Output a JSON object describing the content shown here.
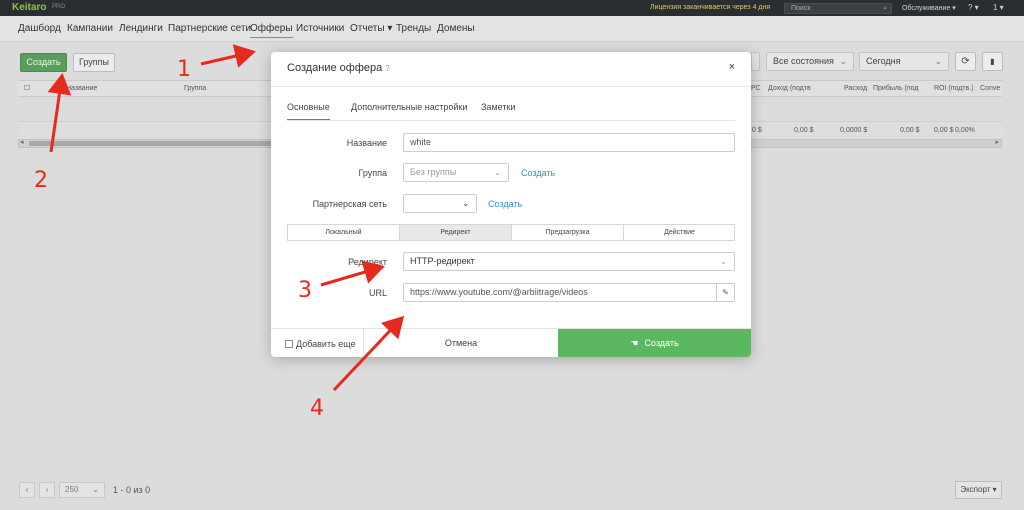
{
  "topbar": {
    "logo": "Keitaro",
    "logo_sub": "PRO",
    "license": "Лицензия заканчивается через 4 дня",
    "search_placeholder": "Поиск",
    "service": "Обслуживание ▾",
    "help": "? ▾",
    "user": "1 ▾"
  },
  "nav": {
    "items": [
      "Дашборд",
      "Кампании",
      "Лендинги",
      "Партнерские сети",
      "Офферы",
      "Источники",
      "Отчеты ▾",
      "Тренды",
      "Домены"
    ],
    "active": "Офферы"
  },
  "toolbar": {
    "create": "Создать",
    "groups": "Группы",
    "states": "Все состояния",
    "period": "Сегодня"
  },
  "table": {
    "headers_left": [
      "Название",
      "Группа"
    ],
    "headers_right": [
      "PC",
      "Доход (подтв",
      "Расход",
      "Прибыль (под",
      "ROI (подтв.)",
      "Conve"
    ],
    "row_values": [
      "0 $",
      "0,00 $",
      "0,0000 $",
      "0,00 $",
      "0,00 $",
      "0,00%"
    ]
  },
  "footer": {
    "prev": "‹",
    "next": "›",
    "per_page": "250",
    "info": "1 - 0 из 0",
    "export": "Экспорт ▾"
  },
  "modal": {
    "title": "Создание оффера",
    "help_mark": "?",
    "close": "×",
    "tabs": [
      "Основные",
      "Дополнительные настройки",
      "Заметки"
    ],
    "name_label": "Название",
    "name_value": "white",
    "group_label": "Группа",
    "group_value": "Без группы",
    "group_create": "Создать",
    "network_label": "Партнерская сеть",
    "network_value": "",
    "network_create": "Создать",
    "segments": [
      "Локальный",
      "Редирект",
      "Предзагрузка",
      "Действие"
    ],
    "segment_active": "Редирект",
    "redirect_label": "Редирект",
    "redirect_value": "HTTP-редирект",
    "url_label": "URL",
    "url_value": "https://www.youtube.com/@arbiitrage/videos",
    "add_more": "Добавить еще",
    "cancel": "Отмена",
    "create": "Создать"
  },
  "annotations": [
    "1",
    "2",
    "3",
    "4"
  ],
  "colors": {
    "accent_green": "#5cb860",
    "arrow_red": "#e62a1d",
    "link_blue": "#3b8ec4"
  }
}
